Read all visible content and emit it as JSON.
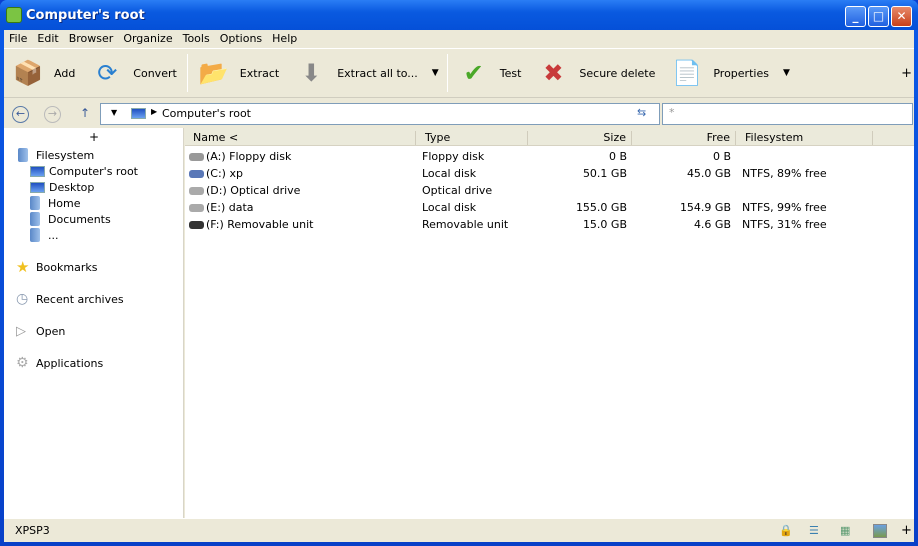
{
  "window": {
    "title": "Computer's root"
  },
  "menu": [
    "File",
    "Edit",
    "Browser",
    "Organize",
    "Tools",
    "Options",
    "Help"
  ],
  "toolbar": {
    "add": "Add",
    "convert": "Convert",
    "extract": "Extract",
    "extract_all": "Extract all to...",
    "test": "Test",
    "secure_delete": "Secure delete",
    "properties": "Properties",
    "more": "+"
  },
  "address": {
    "path": "Computer's root",
    "filter_placeholder": "*"
  },
  "sidebar": {
    "expand": "+",
    "filesystem": "Filesystem",
    "items": [
      "Computer's root",
      "Desktop",
      "Home",
      "Documents",
      "..."
    ],
    "bookmarks": "Bookmarks",
    "recent": "Recent archives",
    "open": "Open",
    "applications": "Applications"
  },
  "columns": [
    "Name <",
    "Type",
    "Size",
    "Free",
    "Filesystem"
  ],
  "rows": [
    {
      "name": "(A:) Floppy disk",
      "type": "Floppy disk",
      "size": "0 B",
      "free": "0 B",
      "fs": ""
    },
    {
      "name": "(C:) xp",
      "type": "Local disk",
      "size": "50.1 GB",
      "free": "45.0 GB",
      "fs": "NTFS, 89% free"
    },
    {
      "name": "(D:) Optical drive",
      "type": "Optical drive",
      "size": "",
      "free": "",
      "fs": ""
    },
    {
      "name": "(E:) data",
      "type": "Local disk",
      "size": "155.0 GB",
      "free": "154.9 GB",
      "fs": "NTFS, 99% free"
    },
    {
      "name": "(F:) Removable unit",
      "type": "Removable unit",
      "size": "15.0 GB",
      "free": "4.6 GB",
      "fs": "NTFS, 31% free"
    }
  ],
  "status": {
    "text": "XPSP3",
    "plus": "+"
  }
}
